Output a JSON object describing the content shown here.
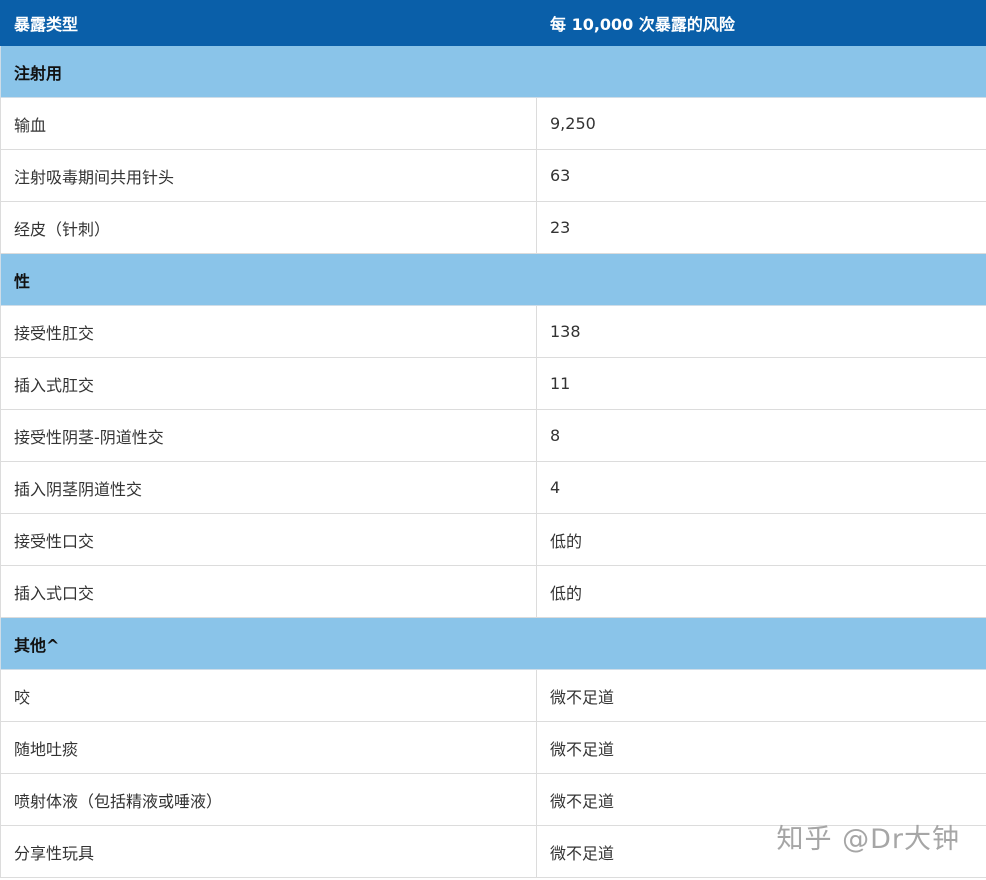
{
  "header": {
    "col1": "暴露类型",
    "col2": "每 10,000 次暴露的风险"
  },
  "sections": [
    {
      "title": "注射用",
      "rows": [
        {
          "type": "输血",
          "risk": "9,250"
        },
        {
          "type": "注射吸毒期间共用针头",
          "risk": "63"
        },
        {
          "type": "经皮（针刺）",
          "risk": "23"
        }
      ]
    },
    {
      "title": "性",
      "rows": [
        {
          "type": "接受性肛交",
          "risk": "138"
        },
        {
          "type": "插入式肛交",
          "risk": "11"
        },
        {
          "type": "接受性阴茎-阴道性交",
          "risk": "8"
        },
        {
          "type": "插入阴茎阴道性交",
          "risk": "4"
        },
        {
          "type": "接受性口交",
          "risk": "低的"
        },
        {
          "type": "插入式口交",
          "risk": "低的"
        }
      ]
    },
    {
      "title": "其他^",
      "rows": [
        {
          "type": "咬",
          "risk": "微不足道"
        },
        {
          "type": "随地吐痰",
          "risk": "微不足道"
        },
        {
          "type": "喷射体液（包括精液或唾液）",
          "risk": "微不足道"
        },
        {
          "type": "分享性玩具",
          "risk": "微不足道"
        }
      ]
    }
  ],
  "watermark": "知乎 @Dr大钟"
}
